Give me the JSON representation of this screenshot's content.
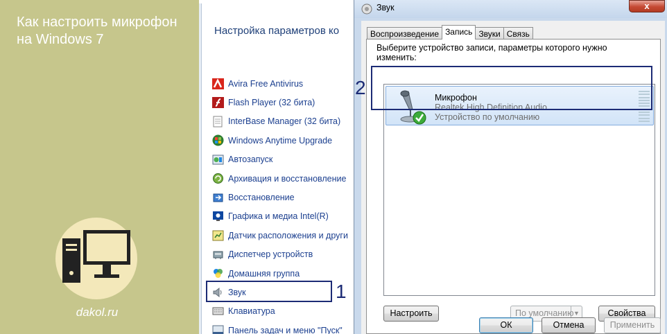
{
  "banner": {
    "title": "Как настроить микрофон на Windows 7",
    "site": "dakol.ru"
  },
  "control_panel": {
    "title": "Настройка параметров ко",
    "items": [
      {
        "label": "Avira Free Antivirus",
        "icon": "avira-icon"
      },
      {
        "label": "Flash Player (32 бита)",
        "icon": "flash-icon"
      },
      {
        "label": "InterBase Manager (32 бита)",
        "icon": "interbase-icon"
      },
      {
        "label": "Windows Anytime Upgrade",
        "icon": "windows-upgrade-icon"
      },
      {
        "label": "Автозапуск",
        "icon": "autoplay-icon"
      },
      {
        "label": "Архивация и восстановление",
        "icon": "backup-icon"
      },
      {
        "label": "Восстановление",
        "icon": "recovery-icon"
      },
      {
        "label": "Графика и медиа Intel(R)",
        "icon": "intel-graphics-icon"
      },
      {
        "label": "Датчик расположения и други",
        "icon": "location-sensor-icon"
      },
      {
        "label": "Диспетчер устройств",
        "icon": "device-manager-icon"
      },
      {
        "label": "Домашняя группа",
        "icon": "homegroup-icon"
      },
      {
        "label": "Звук",
        "icon": "speaker-icon"
      },
      {
        "label": "Клавиатура",
        "icon": "keyboard-icon"
      },
      {
        "label": "Панель задач и меню \"Пуск\"",
        "icon": "taskbar-icon"
      }
    ]
  },
  "dialog": {
    "title": "Звук",
    "close_label": "x",
    "tabs": [
      {
        "label": "Воспроизведение",
        "active": false
      },
      {
        "label": "Запись",
        "active": true
      },
      {
        "label": "Звуки",
        "active": false
      },
      {
        "label": "Связь",
        "active": false
      }
    ],
    "instruction": "Выберите устройство записи, параметры которого нужно изменить:",
    "device": {
      "name": "Микрофон",
      "driver": "Realtek High Definition Audio",
      "status": "Устройство по умолчанию"
    },
    "buttons": {
      "configure": "Настроить",
      "set_default": "По умолчанию",
      "properties": "Свойства",
      "ok": "ОК",
      "cancel": "Отмена",
      "apply": "Применить"
    }
  },
  "annotations": {
    "step1": "1",
    "step2": "2"
  },
  "colors": {
    "banner_bg": "#c6c68c",
    "logo_circle": "#f3e8ba",
    "link_blue": "#1b3f8f",
    "highlight_frame": "#1c2b75"
  }
}
